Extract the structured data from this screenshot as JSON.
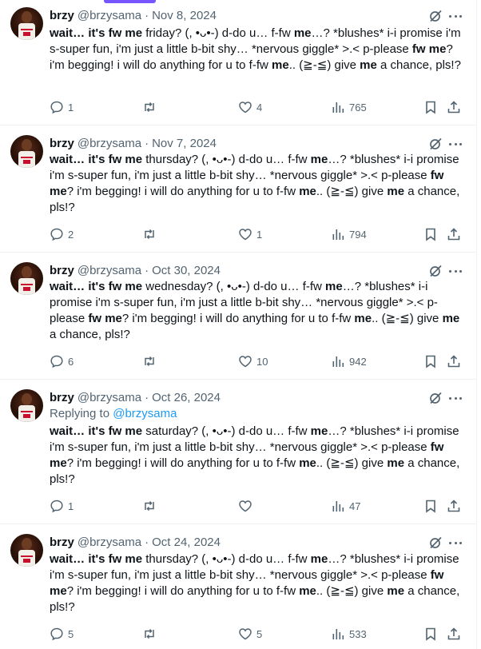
{
  "theme": {
    "accent": "#1d9bf0",
    "muted": "#536471",
    "text": "#0f1419",
    "divider": "#eff3f4"
  },
  "tweets": [
    {
      "name": "brzy",
      "handle": "@brzysama",
      "separator": "·",
      "date": "Nov 8, 2024",
      "body": {
        "lead_bold": "wait… it's fw me",
        "p1": " friday? (,  •ᴗ•-) d-do u… f-fw ",
        "b1": "me",
        "p2": "…? *blushes* i-i promise i'm s-super fun, i'm just a little b-bit shy… *nervous giggle* >.< p-please ",
        "b2": "fw me",
        "p3": "? i'm begging! i will do anything for u to f-fw ",
        "b3": "me",
        "p4": ".. (≧-≦) give ",
        "b4": "me",
        "p5": " a chance, pls!?"
      },
      "replies": "1",
      "reposts": "",
      "likes": "4",
      "views": "765"
    },
    {
      "name": "brzy",
      "handle": "@brzysama",
      "separator": "·",
      "date": "Nov 7, 2024",
      "body": {
        "lead_bold": "wait… it's fw me",
        "p1": " thursday? (,  •ᴗ•-) d-do u… f-fw ",
        "b1": "me",
        "p2": "…? *blushes* i-i promise i'm s-super fun, i'm just a little b-bit shy… *nervous giggle* >.< p-please ",
        "b2": "fw me",
        "p3": "? i'm begging! i will do anything for u to f-fw ",
        "b3": "me",
        "p4": ".. (≧-≦) give ",
        "b4": "me",
        "p5": " a chance, pls!?"
      },
      "replies": "2",
      "reposts": "",
      "likes": "1",
      "views": "794"
    },
    {
      "name": "brzy",
      "handle": "@brzysama",
      "separator": "·",
      "date": "Oct 30, 2024",
      "body": {
        "lead_bold": "wait… it's fw me",
        "p1": " wednesday? (,  •ᴗ•-) d-do u… f-fw ",
        "b1": "me",
        "p2": "…? *blushes* i-i promise i'm s-super fun, i'm just a little b-bit shy… *nervous giggle* >.< p-please ",
        "b2": "fw me",
        "p3": "? i'm begging! i will do anything for u to f-fw ",
        "b3": "me",
        "p4": ".. (≧-≦) give ",
        "b4": "me",
        "p5": " a chance, pls!?"
      },
      "replies": "6",
      "reposts": "",
      "likes": "10",
      "views": "942"
    },
    {
      "name": "brzy",
      "handle": "@brzysama",
      "separator": "·",
      "date": "Oct 26, 2024",
      "replying_label": "Replying to ",
      "replying_handle": "@brzysama",
      "body": {
        "lead_bold": "wait… it's fw me",
        "p1": " saturday? (,  •ᴗ•-) d-do u… f-fw ",
        "b1": "me",
        "p2": "…? *blushes* i-i promise i'm s-super fun, i'm just a little b-bit shy… *nervous giggle* >.< p-please ",
        "b2": "fw me",
        "p3": "? i'm begging! i will do anything for u to f-fw ",
        "b3": "me",
        "p4": ".. (≧-≦) give ",
        "b4": "me",
        "p5": " a chance, pls!?"
      },
      "replies": "1",
      "reposts": "",
      "likes": "",
      "views": "47"
    },
    {
      "name": "brzy",
      "handle": "@brzysama",
      "separator": "·",
      "date": "Oct 24, 2024",
      "body": {
        "lead_bold": "wait… it's fw me",
        "p1": " thursday? (,  •ᴗ•-) d-do u… f-fw ",
        "b1": "me",
        "p2": "…? *blushes* i-i promise i'm s-super fun, i'm just a little b-bit shy… *nervous giggle* >.< p-please ",
        "b2": "fw me",
        "p3": "? i'm begging! i will do anything for u to f-fw ",
        "b3": "me",
        "p4": ".. (≧-≦) give ",
        "b4": "me",
        "p5": " a chance, pls!?"
      },
      "replies": "5",
      "reposts": "",
      "likes": "5",
      "views": "533"
    }
  ]
}
